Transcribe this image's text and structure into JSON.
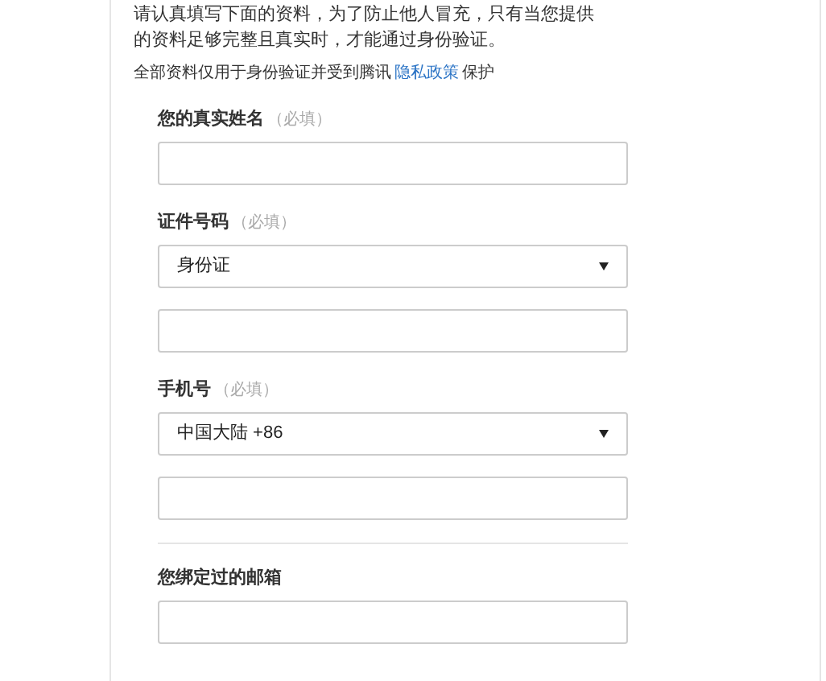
{
  "intro": "请认真填写下面的资料，为了防止他人冒充，只有当您提供的资料足够完整且真实时，才能通过身份验证。",
  "privacy": {
    "before": "全部资料仅用于身份验证并受到腾讯",
    "link": "隐私政策",
    "after": "保护"
  },
  "sections": [
    {
      "label": "您的真实姓名",
      "required_note": "（必填）",
      "divider_before": false,
      "controls": [
        {
          "kind": "input"
        }
      ]
    },
    {
      "label": "证件号码",
      "required_note": "（必填）",
      "divider_before": false,
      "controls": [
        {
          "kind": "select",
          "value": "身份证"
        },
        {
          "kind": "input"
        }
      ]
    },
    {
      "label": "手机号",
      "required_note": "（必填）",
      "divider_before": false,
      "controls": [
        {
          "kind": "select",
          "value": "中国大陆 +86"
        },
        {
          "kind": "input"
        }
      ]
    },
    {
      "label": "您绑定过的邮箱",
      "divider_before": true,
      "controls": [
        {
          "kind": "input"
        }
      ]
    }
  ]
}
